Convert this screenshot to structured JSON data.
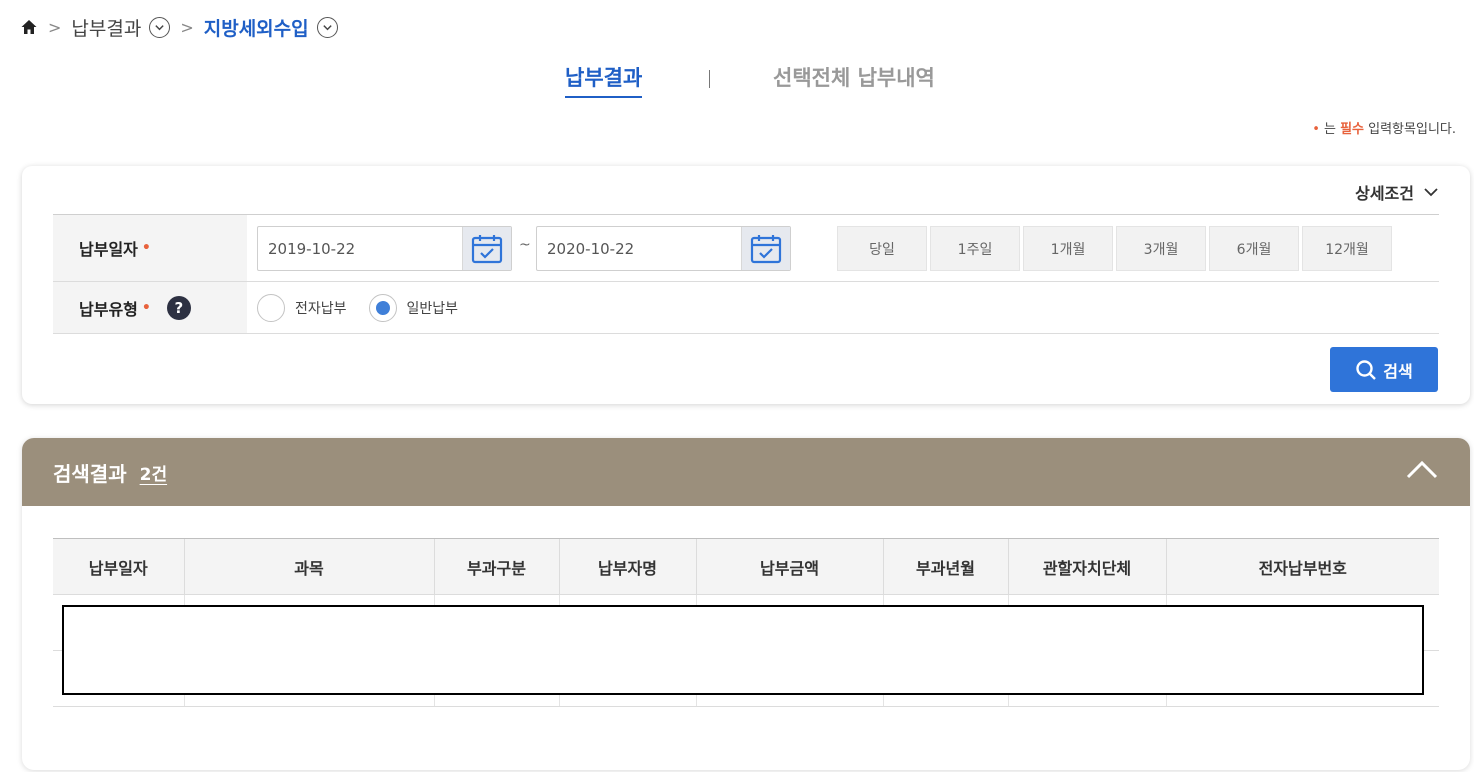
{
  "breadcrumb": {
    "items": [
      "납부결과",
      "지방세외수입"
    ]
  },
  "tabs": [
    {
      "label": "납부결과",
      "active": true
    },
    {
      "label": "선택전체 납부내역",
      "active": false
    }
  ],
  "required_note": {
    "marker": "•",
    "prefix": "는",
    "required_word": "필수",
    "suffix": "입력항목입니다."
  },
  "search": {
    "detail_toggle_label": "상세조건",
    "date_label": "납부일자",
    "required_marker": "•",
    "date_from": "2019-10-22",
    "date_separator": "~",
    "date_to": "2020-10-22",
    "periods": [
      "당일",
      "1주일",
      "1개월",
      "3개월",
      "6개월",
      "12개월"
    ],
    "type_label": "납부유형",
    "help_icon": "?",
    "type_options": [
      {
        "label": "전자납부",
        "checked": false
      },
      {
        "label": "일반납부",
        "checked": true
      }
    ],
    "search_button": "검색"
  },
  "results": {
    "title": "검색결과",
    "count": "2건",
    "columns": [
      "납부일자",
      "과목",
      "부과구분",
      "납부자명",
      "납부금액",
      "부과년월",
      "관할자치단체",
      "전자납부번호"
    ],
    "rows": [
      [
        "",
        "",
        "",
        "",
        "",
        "",
        "",
        ""
      ],
      [
        "",
        "",
        "",
        "",
        "",
        "",
        "",
        ""
      ]
    ]
  },
  "colors": {
    "accent": "#1f5fc6",
    "search_button": "#2f74d9",
    "results_header": "#9b8f7c",
    "required": "#e8623c"
  }
}
